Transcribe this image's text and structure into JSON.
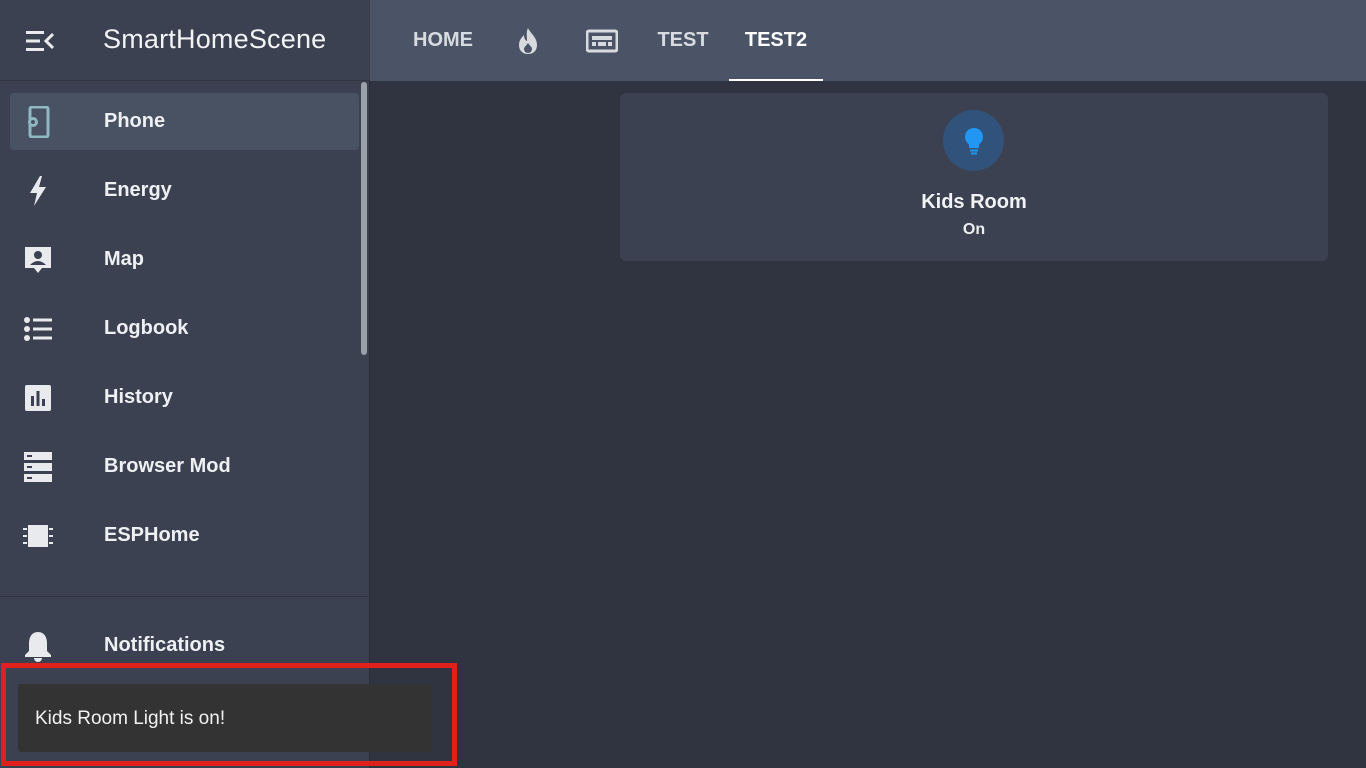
{
  "app": {
    "title": "SmartHomeScene"
  },
  "topbar": {
    "tabs": [
      {
        "label": "HOME"
      },
      {
        "icon": "fire-icon"
      },
      {
        "icon": "keyboard-board-icon"
      },
      {
        "label": "TEST"
      },
      {
        "label": "TEST2",
        "active": true
      }
    ]
  },
  "sidebar": {
    "items": [
      {
        "label": "Phone",
        "icon": "phone-settings-icon",
        "active": true
      },
      {
        "label": "Energy",
        "icon": "lightning-icon"
      },
      {
        "label": "Map",
        "icon": "account-box-icon"
      },
      {
        "label": "Logbook",
        "icon": "list-icon"
      },
      {
        "label": "History",
        "icon": "chart-box-icon"
      },
      {
        "label": "Browser Mod",
        "icon": "server-icon"
      },
      {
        "label": "ESPHome",
        "icon": "chip-icon"
      }
    ],
    "notifications": {
      "label": "Notifications",
      "icon": "bell-icon"
    }
  },
  "card": {
    "name": "Kids Room",
    "state": "On",
    "icon": "lightbulb-icon"
  },
  "toast": {
    "message": "Kids Room Light is on!"
  },
  "colors": {
    "accent_light": "#2196f3",
    "highlight_border": "#e0201a",
    "sidebar_bg": "#3b4150",
    "main_bg": "#2f3440",
    "topbar_bg": "#4b5466"
  }
}
